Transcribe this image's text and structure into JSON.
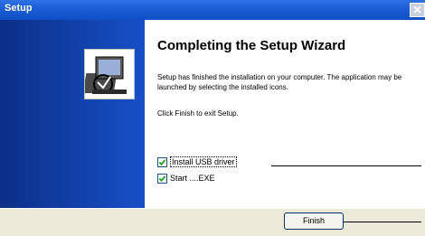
{
  "window": {
    "title": "Setup",
    "close_glyph": "✕"
  },
  "header": {
    "title": "Completing the Setup Wizard"
  },
  "body": {
    "paragraph1": "Setup has finished the installation on your computer. The application may be launched by selecting the installed icons.",
    "paragraph2": "Click Finish to exit Setup."
  },
  "options": {
    "install_usb": {
      "label": "Install USB driver",
      "checked": true
    },
    "start": {
      "label": "Start ....EXE",
      "checked": true
    }
  },
  "buttons": {
    "finish": "Finish"
  },
  "icons": {
    "wizard": "computer-setup-icon",
    "close": "close-icon",
    "check": "checkmark-icon"
  },
  "colors": {
    "titlebar": "#1c5ed6",
    "side_panel": "#0b2f87",
    "bottom_panel": "#ece9d8",
    "check": "#21a121"
  }
}
